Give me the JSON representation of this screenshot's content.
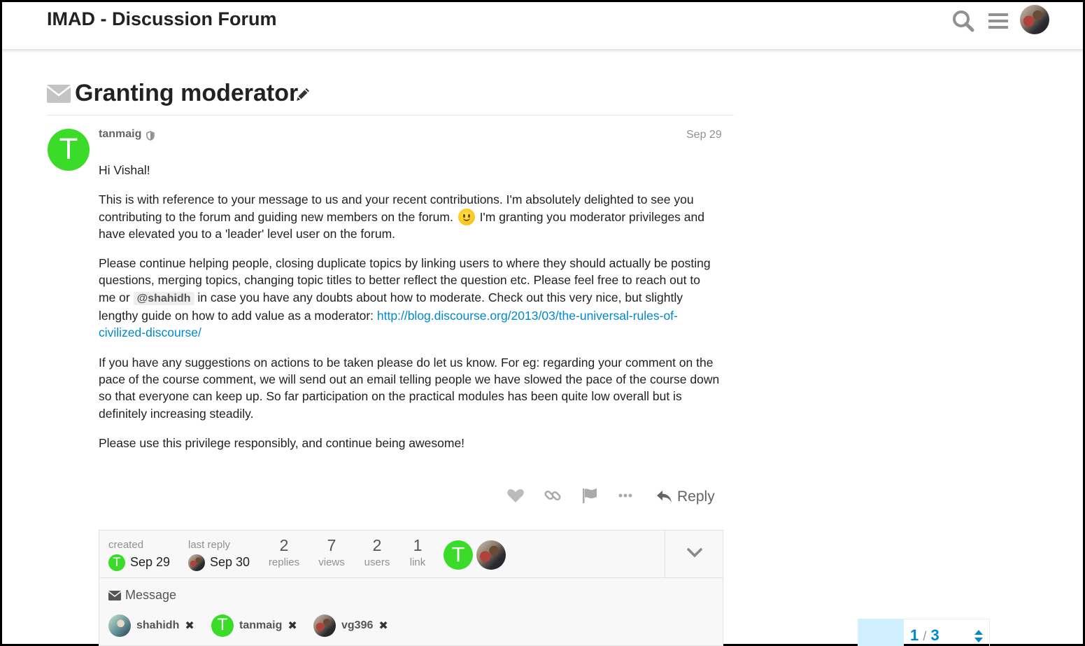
{
  "header": {
    "site_title": "IMAD - Discussion Forum",
    "icons": [
      "search-icon",
      "hamburger-menu-icon",
      "user-avatar"
    ]
  },
  "topic": {
    "title": "Granting moderator",
    "type_icon": "envelope-icon",
    "edit_icon": "pencil-icon"
  },
  "post": {
    "author_initial": "T",
    "author": "tanmaig",
    "author_badge_icon": "shield-icon",
    "date": "Sep 29",
    "greeting": "Hi Vishal!",
    "p1_a": "This is with reference to your message to us and your recent contributions. I'm absolutely delighted to see you contributing to the forum and guiding new members on the forum.",
    "p1_b": "I'm granting you moderator privileges and have elevated you to a 'leader' level user on the forum.",
    "p2_a": "Please continue helping people, closing duplicate topics by linking users to where they should actually be posting questions, merging topics, changing topic titles to better reflect the question etc. Please feel free to reach out to me or",
    "p2_mention": "@shahidh",
    "p2_b": "in case you have any doubts about how to moderate. Check out this very nice, but slightly lengthy guide on how to add value as a moderator:",
    "p2_link": "http://blog.discourse.org/2013/03/the-universal-rules-of-civilized-discourse/",
    "p3": "If you have any suggestions on actions to be taken please do let us know. For eg: regarding your comment on the pace of the course comment, we will send out an email telling people we have slowed the pace of the course down so that everyone can keep up. So far participation on the practical modules has been quite low overall but is definitely increasing steadily.",
    "p4": "Please use this privilege responsibly, and continue being awesome!",
    "reply_label": "Reply",
    "action_icons": [
      "heart-icon",
      "link-icon",
      "flag-icon",
      "more-icon"
    ]
  },
  "topic_map": {
    "created_label": "created",
    "created_initial": "T",
    "created_date": "Sep 29",
    "last_reply_label": "last reply",
    "last_reply_date": "Sep 30",
    "stats": [
      {
        "value": "2",
        "label": "replies"
      },
      {
        "value": "7",
        "label": "views"
      },
      {
        "value": "2",
        "label": "users"
      },
      {
        "value": "1",
        "label": "link"
      }
    ],
    "participant_initial": "T"
  },
  "message": {
    "label": "Message",
    "users": [
      {
        "name": "shahidh",
        "remove": "✖"
      },
      {
        "name": "tanmaig",
        "initial": "T",
        "remove": "✖"
      },
      {
        "name": "vg396",
        "remove": "✖"
      }
    ]
  },
  "timeline": {
    "current": "1",
    "separator": "/",
    "total": "3"
  },
  "colors": {
    "brand_green": "#3adb29",
    "link_blue": "#0088cc",
    "muted_gray": "#919191"
  }
}
